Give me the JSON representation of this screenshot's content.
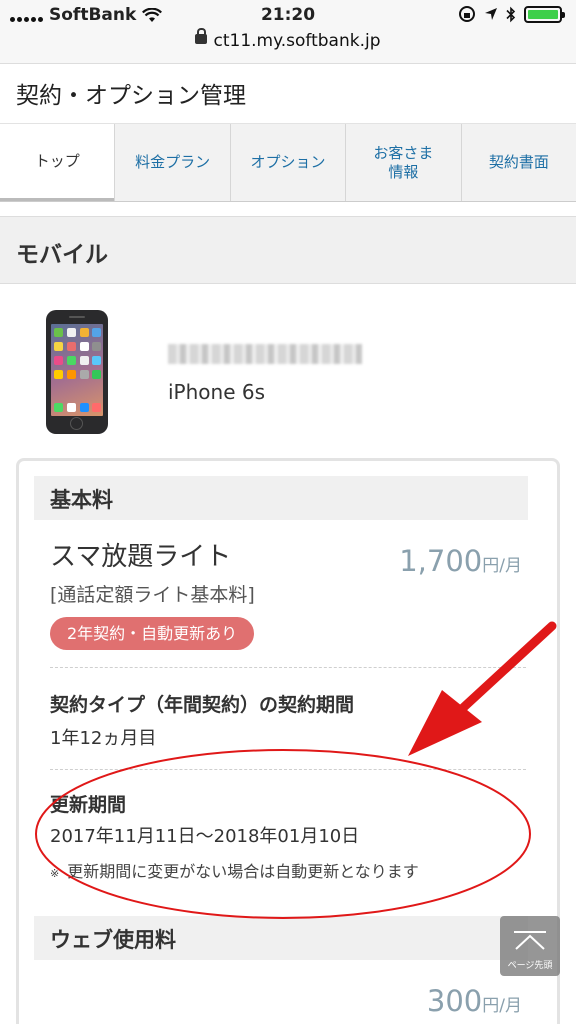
{
  "status_bar": {
    "carrier": "SoftBank",
    "time": "21:20",
    "url": "ct11.my.softbank.jp"
  },
  "header": {
    "title": "契約・オプション管理"
  },
  "tabs": [
    {
      "label": "トップ",
      "active": true
    },
    {
      "label": "料金プラン",
      "active": false
    },
    {
      "label": "オプション",
      "active": false
    },
    {
      "label": "お客さま\n情報",
      "active": false
    },
    {
      "label": "契約書面",
      "active": false
    }
  ],
  "section": {
    "title": "モバイル"
  },
  "device": {
    "model": "iPhone 6s"
  },
  "basic_fee": {
    "heading": "基本料",
    "plan_name": "スマ放題ライト",
    "plan_subtitle": "[通話定額ライト基本料]",
    "price": "1,700",
    "price_unit": "円/月",
    "badge": "2年契約・自動更新あり"
  },
  "contract_type": {
    "label": "契約タイプ（年間契約）の契約期間",
    "value": "1年12ヵ月目"
  },
  "renewal": {
    "label": "更新期間",
    "value": "2017年11月11日〜2018年01月10日",
    "note_mark": "※",
    "note": "更新期間に変更がない場合は自動更新となります"
  },
  "web_fee": {
    "heading": "ウェブ使用料",
    "price": "300",
    "price_unit": "円/月"
  },
  "page_top_button": {
    "label": "ページ先頭"
  },
  "colors": {
    "link": "#1d6fa5",
    "badge": "#e07070",
    "price": "#8aa0ad",
    "annotation": "#e01818"
  }
}
